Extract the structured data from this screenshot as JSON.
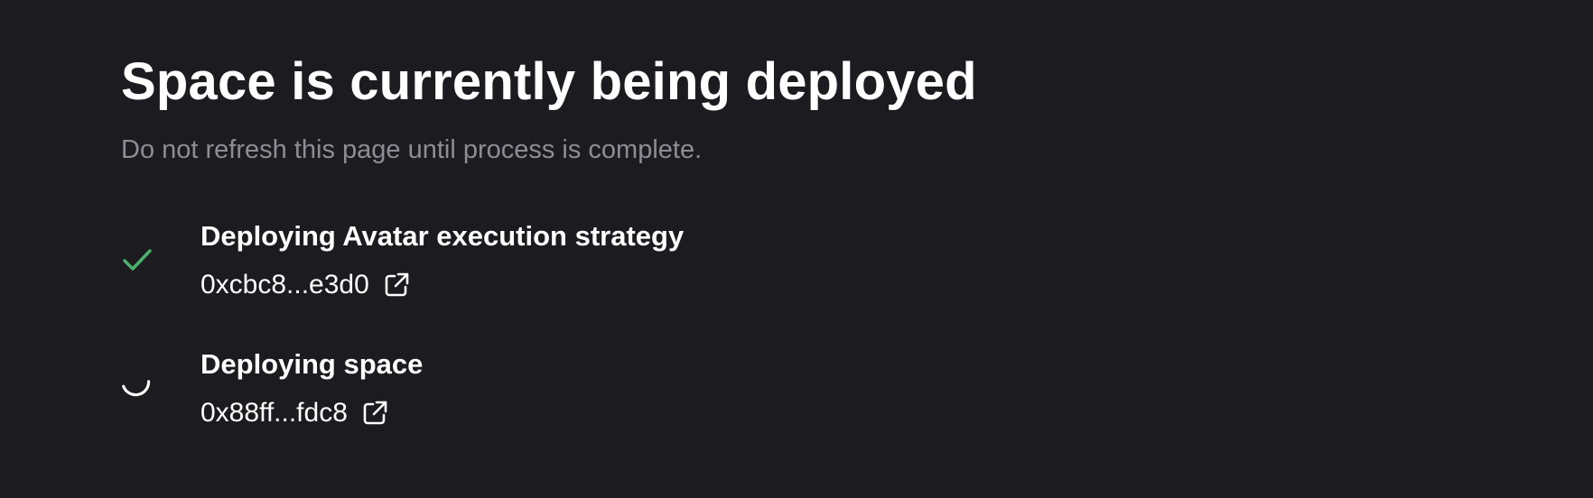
{
  "header": {
    "title": "Space is currently being deployed",
    "subtitle": "Do not refresh this page until process is complete."
  },
  "steps": [
    {
      "title": "Deploying Avatar execution strategy",
      "address": "0xcbc8...e3d0",
      "status": "complete",
      "status_icon": "check-icon",
      "link_icon": "external-link-icon"
    },
    {
      "title": "Deploying space",
      "address": "0x88ff...fdc8",
      "status": "in-progress",
      "status_icon": "loading-spinner-icon",
      "link_icon": "external-link-icon"
    }
  ],
  "colors": {
    "background": "#1c1b20",
    "text": "#ffffff",
    "muted_text": "#8e8c95",
    "success": "#4caf6a"
  }
}
